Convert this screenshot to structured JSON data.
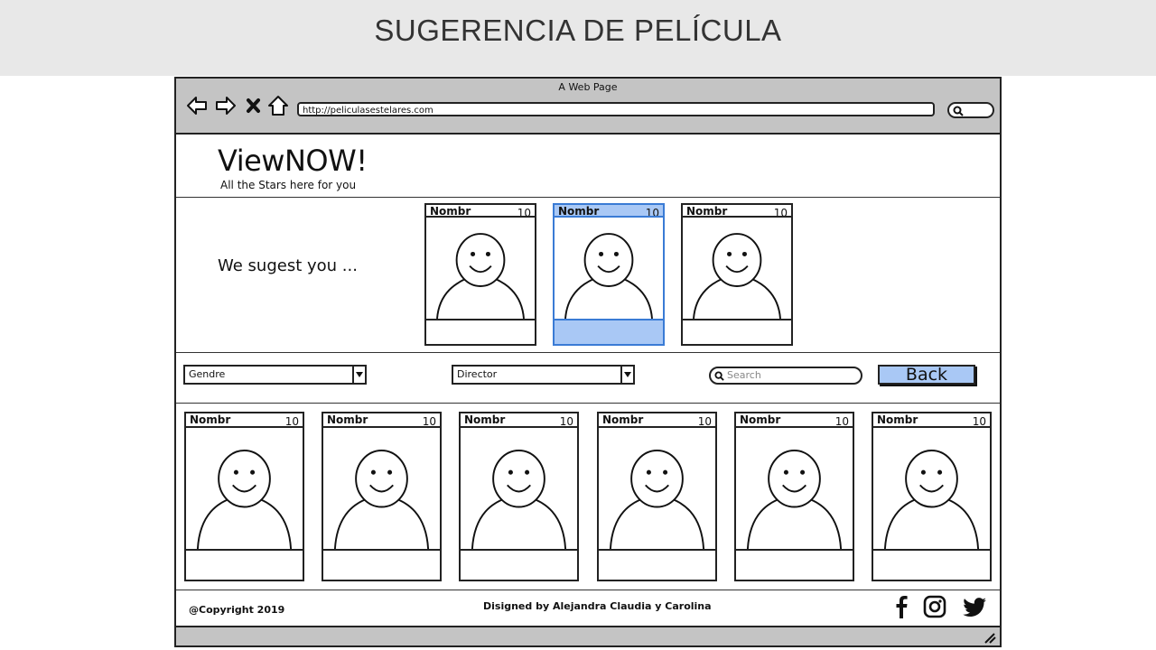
{
  "slide": {
    "title": "SUGERENCIA DE PELÍCULA"
  },
  "browser": {
    "window_title": "A Web Page",
    "url": "http://peliculasestelares.com",
    "icons": [
      "back-arrow-icon",
      "forward-arrow-icon",
      "close-x-icon",
      "home-icon",
      "search-icon"
    ]
  },
  "site": {
    "logo": "ViewNOW!",
    "tagline": "All the Stars here for you"
  },
  "suggestions": {
    "label": "We sugest you ...",
    "cards": [
      {
        "name": "Nombr",
        "rating": "10",
        "selected": false
      },
      {
        "name": "Nombr",
        "rating": "10",
        "selected": true
      },
      {
        "name": "Nombr",
        "rating": "10",
        "selected": false
      }
    ]
  },
  "filters": {
    "genre_value": "Gendre",
    "director_value": "Director",
    "search_placeholder": "Search",
    "back_label": "Back"
  },
  "movies": [
    {
      "name": "Nombr",
      "rating": "10"
    },
    {
      "name": "Nombr",
      "rating": "10"
    },
    {
      "name": "Nombr",
      "rating": "10"
    },
    {
      "name": "Nombr",
      "rating": "10"
    },
    {
      "name": "Nombr",
      "rating": "10"
    },
    {
      "name": "Nombr",
      "rating": "10"
    }
  ],
  "footer": {
    "copyright": "@Copyright 2019",
    "credits": "Disigned by Alejandra Claudia y Carolina",
    "social_icons": [
      "facebook-icon",
      "instagram-icon",
      "twitter-icon"
    ]
  },
  "colors": {
    "selected_fill": "#a9c8f5",
    "selected_border": "#3a7bd5",
    "chrome": "#c4c4c4",
    "slide_header": "#e8e8e8"
  }
}
